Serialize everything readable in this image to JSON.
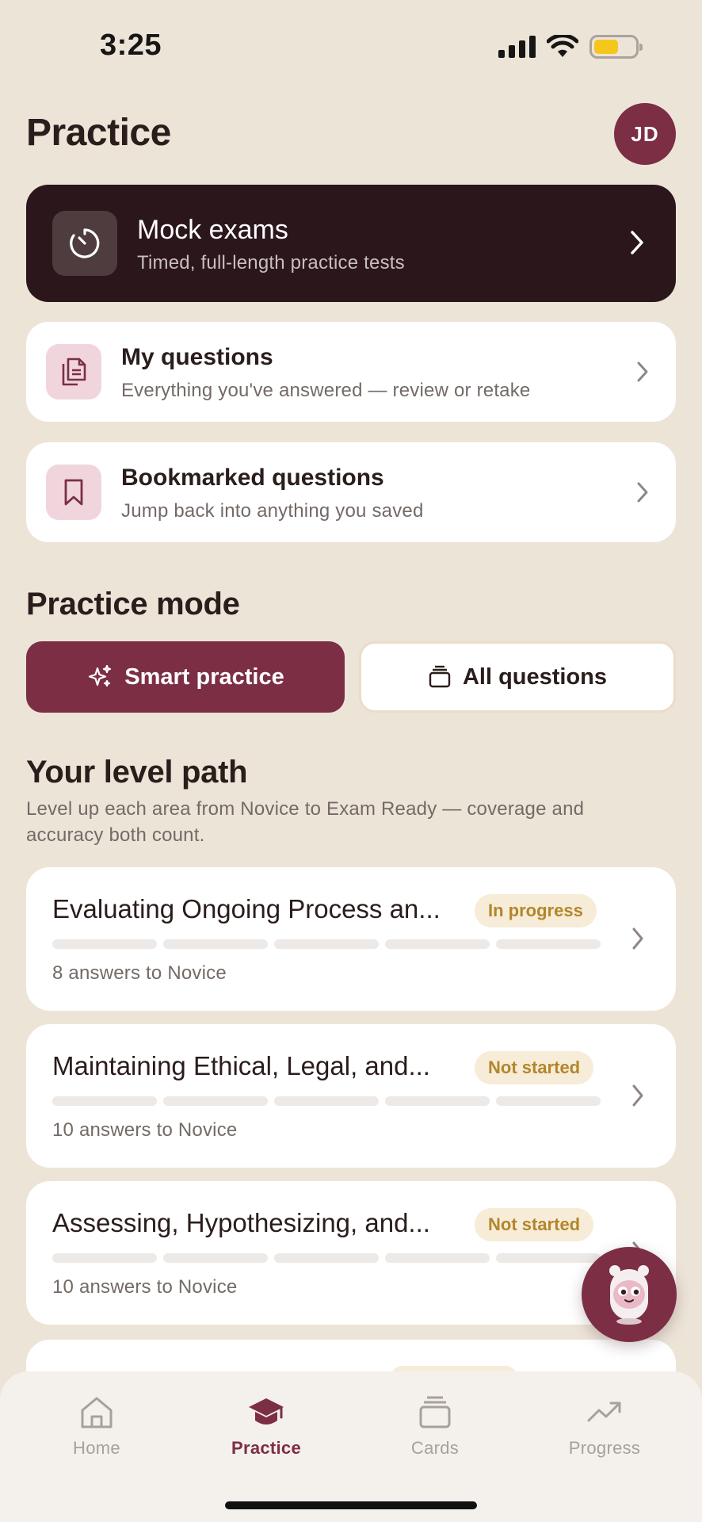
{
  "status_bar": {
    "time": "3:25"
  },
  "header": {
    "title": "Practice",
    "avatar_initials": "JD"
  },
  "mock_exams": {
    "title": "Mock exams",
    "subtitle": "Timed, full-length practice tests"
  },
  "my_questions": {
    "title": "My questions",
    "subtitle": "Everything you've answered — review or retake"
  },
  "bookmarked": {
    "title": "Bookmarked questions",
    "subtitle": "Jump back into anything you saved"
  },
  "practice_mode": {
    "title": "Practice mode",
    "smart_label": "Smart practice",
    "all_label": "All questions",
    "selected": "Smart practice"
  },
  "level_path": {
    "title": "Your level path",
    "description": "Level up each area from Novice to Exam Ready — coverage and accuracy both count.",
    "items": [
      {
        "title": "Evaluating Ongoing Process an...",
        "status": "In progress",
        "subtitle": "8 answers to Novice",
        "segments_total": 5,
        "segments_filled": 0
      },
      {
        "title": "Maintaining Ethical, Legal, and...",
        "status": "Not started",
        "subtitle": "10 answers to Novice",
        "segments_total": 5,
        "segments_filled": 0
      },
      {
        "title": "Assessing, Hypothesizing, and...",
        "status": "Not started",
        "subtitle": "10 answers to Novice",
        "segments_total": 5,
        "segments_filled": 0
      }
    ]
  },
  "tabbar": {
    "tabs": [
      {
        "label": "Home",
        "icon": "home-icon"
      },
      {
        "label": "Practice",
        "icon": "graduation-cap-icon"
      },
      {
        "label": "Cards",
        "icon": "cards-stack-icon"
      },
      {
        "label": "Progress",
        "icon": "trend-up-icon"
      }
    ],
    "active": "Practice"
  },
  "colors": {
    "background": "#ede4d8",
    "accent": "#7c2e45",
    "dark_card": "#2b161c",
    "badge_bg": "#f6ecd8",
    "badge_text": "#b3862a",
    "icon_tile": "#f0d6dc"
  }
}
